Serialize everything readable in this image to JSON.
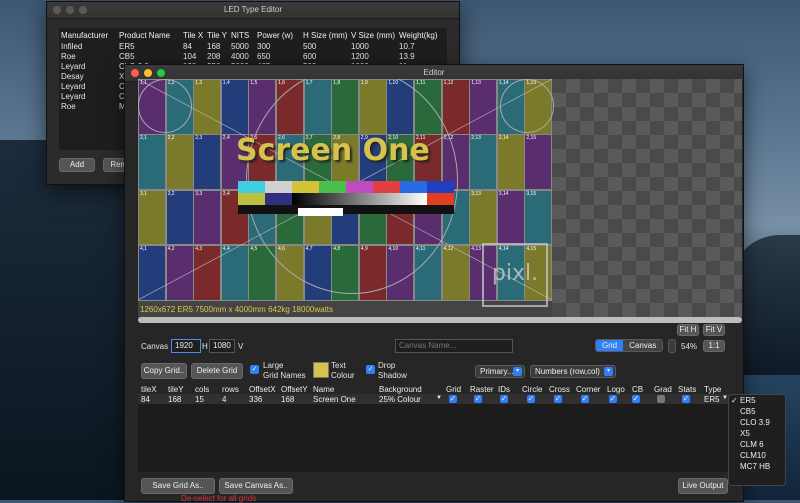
{
  "led_window": {
    "title": "LED Type Editor",
    "columns": [
      "Manufacturer",
      "Product Name",
      "Tile X",
      "Tile Y",
      "NITS",
      "Power (w)",
      "H Size (mm)",
      "V Size (mm)",
      "Weight(kg)"
    ],
    "rows": [
      [
        "Infiled",
        "ER5",
        "84",
        "168",
        "5000",
        "300",
        "500",
        "1000",
        "10.7"
      ],
      [
        "Roe",
        "CB5",
        "104",
        "208",
        "4000",
        "650",
        "600",
        "1200",
        "13.9"
      ],
      [
        "Leyard",
        "CLO 3.9",
        "128",
        "256",
        "5000",
        "465",
        "500",
        "1000",
        "11"
      ],
      [
        "Desay",
        "X",
        "",
        "",
        "",
        "",
        "",
        "",
        ""
      ],
      [
        "Leyard",
        "C",
        "",
        "",
        "",
        "",
        "",
        "",
        ""
      ],
      [
        "Leyard",
        "C",
        "",
        "",
        "",
        "",
        "",
        "",
        ""
      ],
      [
        "Roe",
        "M",
        "",
        "",
        "",
        "",
        "",
        "",
        ""
      ]
    ],
    "add_label": "Add",
    "remove_label": "Remo"
  },
  "editor": {
    "title": "Editor",
    "screen_title": "Screen One",
    "dims_text": "1260x672 ER5 7500mm x 4000mm 642kg 18000watts",
    "logo_text": "pixl.",
    "tile_rows": [
      [
        "1,1",
        "1,2",
        "1,3",
        "1,4",
        "1,5",
        "1,6",
        "1,7",
        "1,8",
        "1,9",
        "1,10",
        "1,11",
        "1,12",
        "1,13",
        "1,14",
        "1,15"
      ],
      [
        "2,1",
        "2,2",
        "2,3",
        "2,4",
        "2,5",
        "2,6",
        "2,7",
        "2,8",
        "2,9",
        "2,10",
        "2,11",
        "2,12",
        "2,13",
        "2,14",
        "2,15"
      ],
      [
        "3,1",
        "3,2",
        "3,3",
        "3,4",
        "3,5",
        "3,6",
        "3,7",
        "3,8",
        "3,9",
        "3,10",
        "3,11",
        "3,12",
        "3,13",
        "3,14",
        "3,15"
      ],
      [
        "4,1",
        "4,2",
        "4,3",
        "4,4",
        "4,5",
        "4,6",
        "4,7",
        "4,8",
        "4,9",
        "4,10",
        "4,11",
        "4,12",
        "4,13",
        "4,14",
        "4,15"
      ]
    ],
    "tile_colors": [
      "#5a2d6e",
      "#2b6b78",
      "#7a7a2a",
      "#233c7a",
      "#5a2d6e",
      "#7a2a2a",
      "#2b6b78",
      "#2a6a3a",
      "#7a7a2a",
      "#233c7a",
      "#2a6a3a",
      "#7a2a2a",
      "#5a2d6e",
      "#2b6b78",
      "#7a7a2a"
    ],
    "canvas_label": "Canvas",
    "canvas_w": "1920",
    "h_label": "H",
    "canvas_h": "1080",
    "v_label": "V",
    "canvas_name_placeholder": "Canvas Name...",
    "grid_tab": "Grid",
    "canvas_tab": "Canvas",
    "zoom": "54%",
    "fit_h": "Fit H",
    "fit_v": "Fit V",
    "one_to_one": "1:1",
    "copy_grid": "Copy Grid..",
    "delete_grid": "Delete Grid",
    "large_grid_names_1": "Large",
    "large_grid_names_2": "Grid Names",
    "text_colour_1": "Text",
    "text_colour_2": "Colour",
    "drop_shadow_1": "Drop",
    "drop_shadow_2": "Shadow",
    "primary_select": "Primary...",
    "numbers_select": "Numbers (row,col)",
    "grid_columns": [
      "tileX",
      "tileY",
      "cols",
      "rows",
      "OffsetX",
      "OffsetY",
      "Name",
      "Background",
      "Grid",
      "Raster",
      "IDs",
      "Circle",
      "Cross",
      "Corner",
      "Logo",
      "CB",
      "Grad",
      "Stats",
      "Type"
    ],
    "grid_row": {
      "tileX": "84",
      "tileY": "168",
      "cols": "15",
      "rows": "4",
      "offx": "336",
      "offy": "168",
      "name": "Screen One",
      "bg": "25% Colour",
      "type": "ER5"
    },
    "save_grid": "Save Grid As..",
    "save_canvas": "Save Canvas As..",
    "live_output": "Live Output",
    "deselect_note": "De-select for all grids",
    "type_options": [
      "ER5",
      "CB5",
      "CLO 3.9",
      "X5",
      "CLM 6",
      "CLM10",
      "MC7 HB"
    ],
    "check_mark": "✓"
  }
}
